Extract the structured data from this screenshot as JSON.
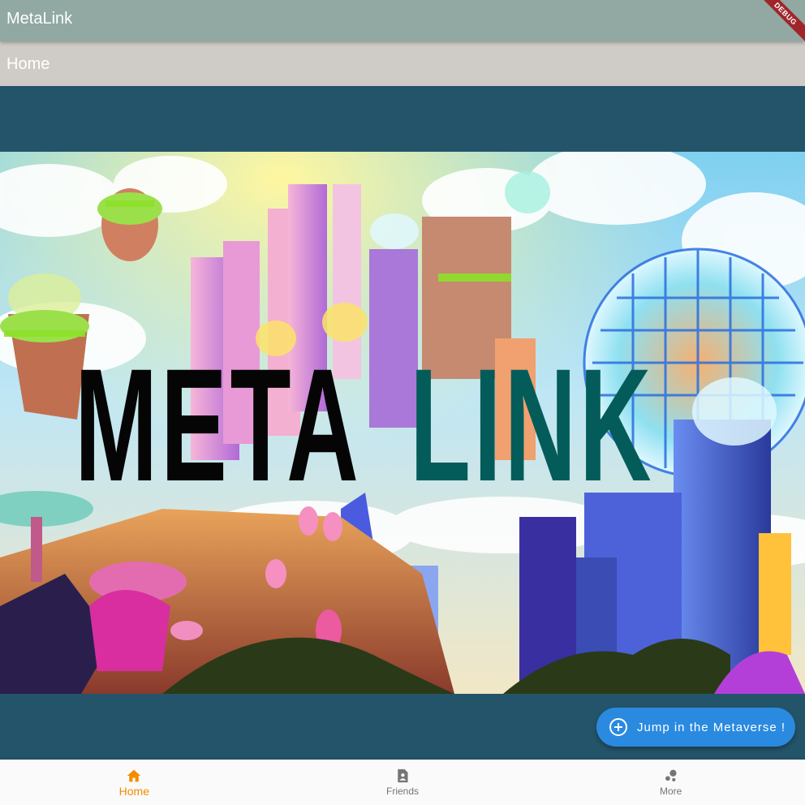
{
  "app": {
    "title": "MetaLink",
    "debug_badge": "DEBUG"
  },
  "header": {
    "title": "Home"
  },
  "hero": {
    "logo_part1": "META",
    "logo_part2": "LINK",
    "logo_colors": {
      "meta": "#050505",
      "link": "#045c5a"
    }
  },
  "fab": {
    "label": "Jump in the Metaverse !",
    "icon": "add-circle-icon",
    "color": "#2a8ae0"
  },
  "bottom_nav": {
    "items": [
      {
        "label": "Home",
        "icon": "home-icon",
        "active": true
      },
      {
        "label": "Friends",
        "icon": "contact-page-icon",
        "active": false
      },
      {
        "label": "More",
        "icon": "bubble-chart-icon",
        "active": false
      }
    ],
    "active_color": "#f28c00",
    "inactive_color": "#757575"
  },
  "colors": {
    "appbar": "#91a9a2",
    "subheader": "#cfcbc7",
    "background": "#24546a"
  }
}
